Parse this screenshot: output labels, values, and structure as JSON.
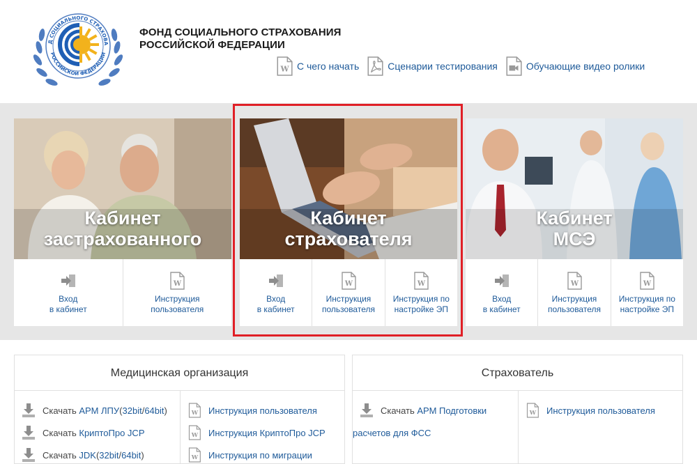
{
  "header": {
    "org_line1": "ФОНД СОЦИАЛЬНОГО СТРАХОВАНИЯ",
    "org_line2": "РОССИЙСКОЙ ФЕДЕРАЦИИ",
    "emblem_text_top": "ФОНД СОЦИАЛЬНОГО СТРАХОВАНИЯ",
    "emblem_text_bottom": "РОССИЙСКОЙ ФЕДЕРАЦИИ",
    "links": [
      {
        "label": "С чего начать",
        "icon": "word-doc-icon"
      },
      {
        "label": "Сценарии тестирования",
        "icon": "pdf-doc-icon"
      },
      {
        "label": "Обучающие видео ролики",
        "icon": "video-icon"
      }
    ]
  },
  "cards": [
    {
      "title_line1": "Кабинет",
      "title_line2": "застрахованного",
      "actions": [
        {
          "line1": "Вход",
          "line2": "в кабинет",
          "icon": "login-arrow-icon"
        },
        {
          "line1": "Инструкция",
          "line2": "пользователя",
          "icon": "word-doc-icon"
        }
      ]
    },
    {
      "title_line1": "Кабинет",
      "title_line2": "страхователя",
      "actions": [
        {
          "line1": "Вход",
          "line2": "в кабинет",
          "icon": "login-arrow-icon"
        },
        {
          "line1": "Инструкция",
          "line2": "пользователя",
          "icon": "word-doc-icon"
        },
        {
          "line1": "Инструкция по",
          "line2": "настройке ЭП",
          "icon": "word-doc-icon"
        }
      ]
    },
    {
      "title_line1": "Кабинет",
      "title_line2": "МСЭ",
      "actions": [
        {
          "line1": "Вход",
          "line2": "в кабинет",
          "icon": "login-arrow-icon"
        },
        {
          "line1": "Инструкция",
          "line2": "пользователя",
          "icon": "word-doc-icon"
        },
        {
          "line1": "Инструкция по",
          "line2": "настройке ЭП",
          "icon": "word-doc-icon"
        }
      ]
    }
  ],
  "panels": {
    "medical": {
      "title": "Медицинская организация",
      "downloads": [
        {
          "prefix": "Скачать",
          "link": "АРМ ЛПУ",
          "suffix_open": " (",
          "link2": "32bit",
          "sep": " / ",
          "link3": "64bit",
          "suffix_close": ")"
        },
        {
          "prefix": "Скачать",
          "link": "КриптоПро JCP",
          "suffix_open": "",
          "link2": "",
          "sep": "",
          "link3": "",
          "suffix_close": ""
        },
        {
          "prefix": "Скачать",
          "link": "JDK",
          "suffix_open": " (",
          "link2": "32bit",
          "sep": " / ",
          "link3": "64bit",
          "suffix_close": ")"
        }
      ],
      "docs": [
        "Инструкция пользователя",
        "Инструкция КриптоПро JCP",
        "Инструкция по миграции"
      ]
    },
    "insurer": {
      "title": "Страхователь",
      "download_prefix": "Скачать",
      "download_link_line1": "АРМ Подготовки",
      "download_link_line2": "расчетов для ФСС",
      "docs": [
        "Инструкция пользователя"
      ]
    }
  },
  "colors": {
    "link": "#1e5a99",
    "highlight": "#e01f26",
    "band": "#e6e6e6"
  }
}
